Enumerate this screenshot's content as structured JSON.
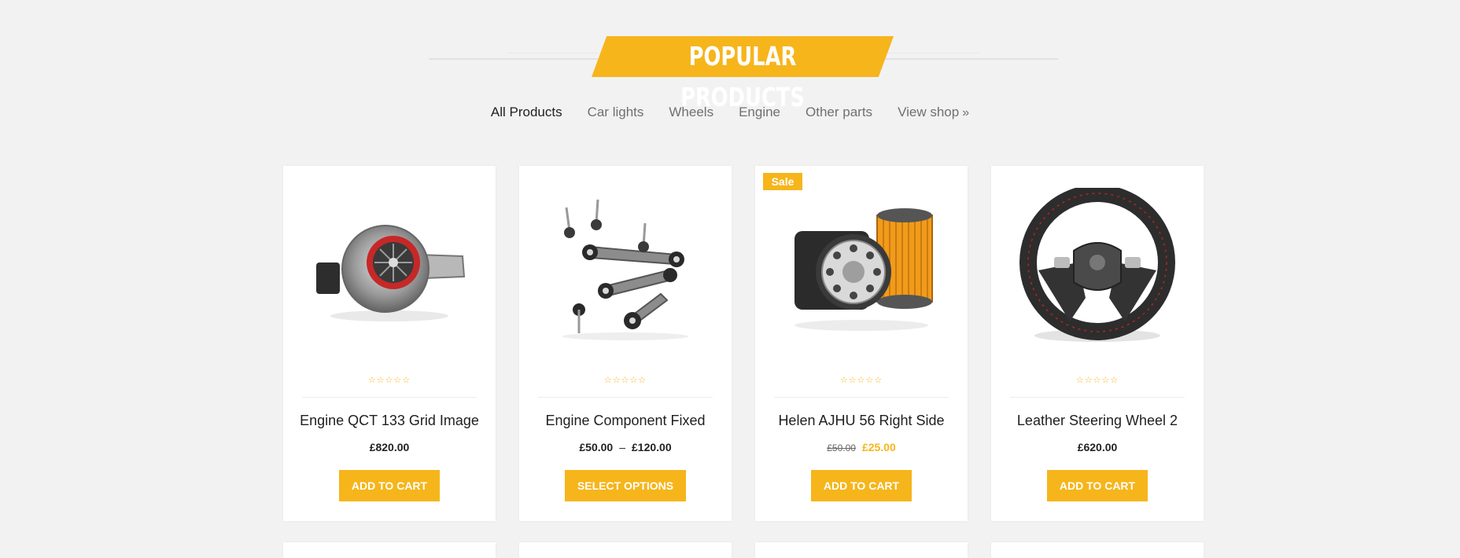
{
  "header": {
    "title": "POPULAR PRODUCTS"
  },
  "tabs": [
    {
      "label": "All Products",
      "active": true
    },
    {
      "label": "Car lights",
      "active": false
    },
    {
      "label": "Wheels",
      "active": false
    },
    {
      "label": "Engine",
      "active": false
    },
    {
      "label": "Other parts",
      "active": false
    },
    {
      "label": "View shop",
      "active": false,
      "icon": "double-chevron-right-icon"
    }
  ],
  "products": [
    {
      "name": "Engine QCT 133 Grid Image",
      "image": "turbocharger-image",
      "rating": "0 of 5 stars",
      "price": "£820.00",
      "button": "ADD TO CART"
    },
    {
      "name": "Engine Component Fixed",
      "image": "suspension-parts-image",
      "rating": "0 of 5 stars",
      "price_min": "£50.00",
      "price_sep": "–",
      "price_max": "£120.00",
      "button": "SELECT OPTIONS"
    },
    {
      "name": "Helen AJHU 56 Right Side",
      "image": "oil-filters-image",
      "badge": "Sale",
      "rating": "0 of 5 stars",
      "old_price": "£50.00",
      "price": "£25.00",
      "button": "ADD TO CART"
    },
    {
      "name": "Leather Steering Wheel 2",
      "image": "steering-wheel-image",
      "rating": "0 of 5 stars",
      "price": "£620.00",
      "button": "ADD TO CART"
    }
  ],
  "colors": {
    "accent": "#f6b51b",
    "background": "#f2f2f2"
  }
}
